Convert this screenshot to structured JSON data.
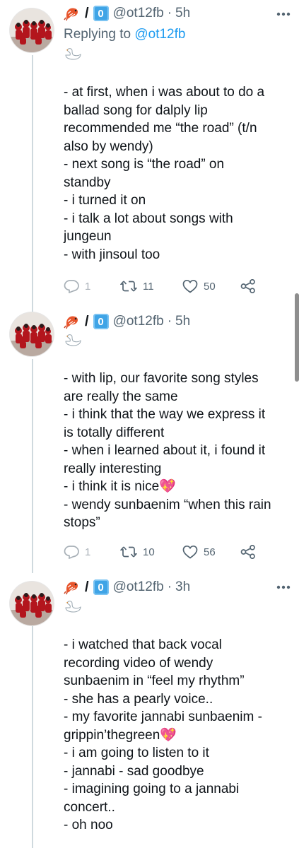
{
  "tweets": [
    {
      "handle": "@ot12fb",
      "time": "5h",
      "replying_prefix": "Replying to ",
      "replying_to": "@ot12fb",
      "keycap": "0",
      "lines": [
        "- at first, when i was about to do a",
        "ballad song for dalply lip",
        "recommended me “the road” (t/n",
        "also by wendy)",
        "- next song is “the road” on",
        "standby",
        "- i turned it on",
        "- i talk a lot about songs with",
        "jungeun",
        "- with jinsoul too"
      ],
      "replies": "1",
      "retweets": "11",
      "likes": "50"
    },
    {
      "handle": "@ot12fb",
      "time": "5h",
      "keycap": "0",
      "lines": [
        "- with lip, our favorite song styles",
        "are really the same",
        "- i think that the way we express it",
        "is totally different",
        "- when i learned about it, i found it",
        "really interesting",
        "- i think it is nice💖",
        "- wendy sunbaenim “when this rain",
        "stops”"
      ],
      "replies": "1",
      "retweets": "10",
      "likes": "56"
    },
    {
      "handle": "@ot12fb",
      "time": "3h",
      "keycap": "0",
      "lines": [
        "- i watched that back vocal",
        "recording video of wendy",
        "sunbaenim in “feel my rhythm”",
        "- she has a pearly voice..",
        "- my favorite jannabi sunbaenim -",
        "grippin’thegreen💖",
        "- i am going to listen to it",
        "- jannabi - sad goodbye",
        "- imagining going to a jannabi",
        "concert..",
        "- oh noo"
      ]
    }
  ],
  "separator": "/",
  "dot": "·",
  "icons": {
    "shrimp": "shrimp-icon",
    "swan": "swan-icon",
    "more": "more-icon",
    "reply": "reply-icon",
    "retweet": "retweet-icon",
    "like": "heart-icon",
    "share": "share-icon"
  },
  "colors": {
    "link": "#1d9bf0",
    "secondary_text": "#536471",
    "thread_line": "#cfd9de",
    "keycap": "#3fa4e6"
  }
}
